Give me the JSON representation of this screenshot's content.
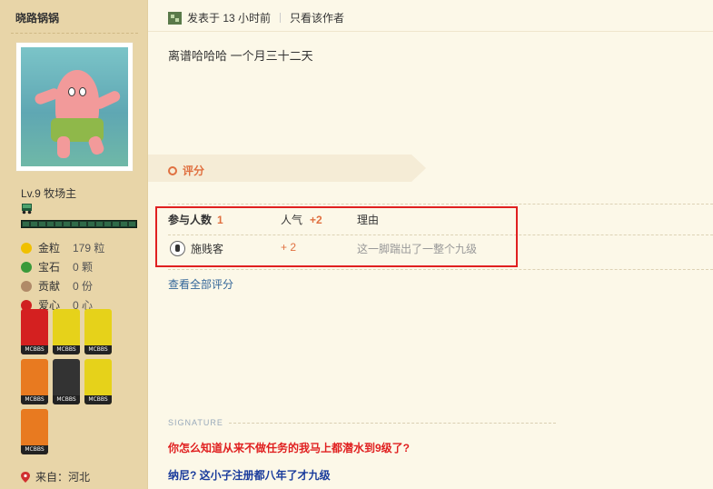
{
  "user": {
    "name": "晓路锅锅",
    "level": "Lv.9 牧场主",
    "stats": [
      {
        "icon": "gold-coin-icon",
        "label": "金粒",
        "value": "179 粒",
        "color": "#f0c000"
      },
      {
        "icon": "gem-icon",
        "label": "宝石",
        "value": "0 颗",
        "color": "#3a9a3a"
      },
      {
        "icon": "contribution-icon",
        "label": "贡献",
        "value": "0 份",
        "color": "#b08a68"
      },
      {
        "icon": "apple-heart-icon",
        "label": "爱心",
        "value": "0 心",
        "color": "#d02020"
      }
    ],
    "medals": [
      {
        "name": "java-medal",
        "tag": "MCBBS",
        "color": "#d42020"
      },
      {
        "name": "stone-pickaxe-medal",
        "tag": "MCBBS",
        "color": "#e6d21a"
      },
      {
        "name": "iron-pickaxe-medal",
        "tag": "MCBBS",
        "color": "#e6d21a"
      },
      {
        "name": "seeds-medal",
        "tag": "MCBBS",
        "color": "#e87a20"
      },
      {
        "name": "ore-medal",
        "tag": "MCBBS",
        "color": "#333333"
      },
      {
        "name": "diamond-pickaxe-medal",
        "tag": "MCBBS",
        "color": "#e6d21a"
      },
      {
        "name": "ten-years-medal",
        "tag": "MCBBS",
        "color": "#e87a20"
      }
    ],
    "from_label": "来自：河北"
  },
  "post": {
    "posted_time": "发表于 13 小时前",
    "only_author": "只看该作者",
    "body": "离谱哈哈哈 一个月三十二天"
  },
  "rating": {
    "title": "评分",
    "participants_label": "参与人数",
    "participants_count": "1",
    "popularity_label": "人气",
    "popularity_value": "+2",
    "reason_label": "理由",
    "rows": [
      {
        "rater": "施贱客",
        "score": "+ 2",
        "reason": "这一脚踹出了一整个九级"
      }
    ],
    "view_all": "查看全部评分"
  },
  "signature": {
    "label": "SIGNATURE",
    "line1": "你怎么知道从来不做任务的我马上都潜水到9级了?",
    "line2": "纳尼? 这小子注册都八年了才九级"
  }
}
